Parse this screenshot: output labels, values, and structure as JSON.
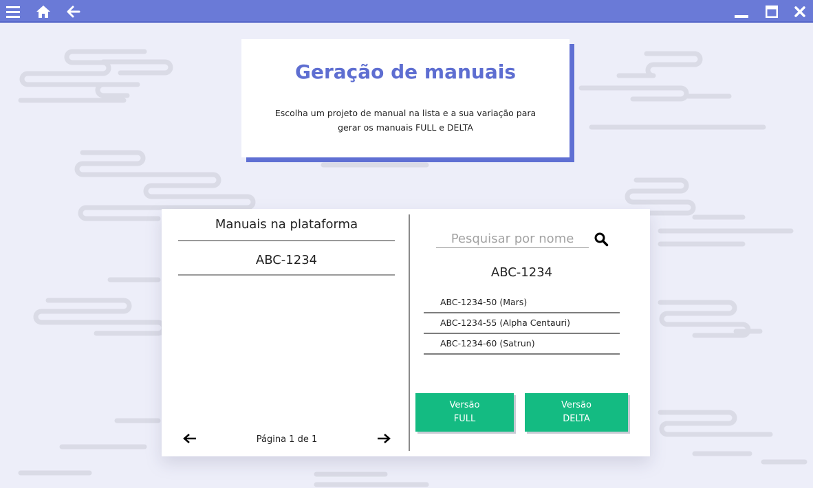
{
  "window": {
    "icons": [
      "menu-icon",
      "home-icon",
      "back-arrow-icon",
      "minimize-icon",
      "maximize-icon",
      "close-icon"
    ],
    "accent_color": "#6a7ad7"
  },
  "header": {
    "title": "Geração de manuais",
    "description": "Escolha um projeto de manual na lista e a sua variação para gerar os manuais FULL e DELTA"
  },
  "left_panel": {
    "title": "Manuais na plataforma",
    "items": [
      "ABC-1234"
    ],
    "pagination": "Página 1 de 1"
  },
  "right_panel": {
    "search_placeholder": "Pesquisar por nome",
    "selected_title": "ABC-1234",
    "variants": [
      "ABC-1234-50 (Mars)",
      "ABC-1234-55 (Alpha Centauri)",
      "ABC-1234-60 (Satrun)"
    ],
    "buttons": {
      "full": {
        "line1": "Versão",
        "line2": "FULL"
      },
      "delta": {
        "line1": "Versão",
        "line2": "DELTA"
      }
    },
    "button_color": "#14bb82"
  }
}
